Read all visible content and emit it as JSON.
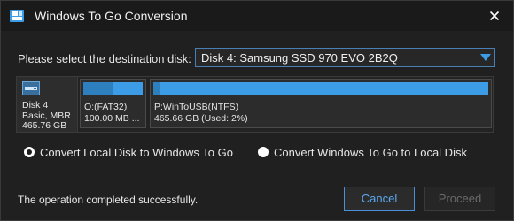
{
  "window": {
    "title": "Windows To Go Conversion"
  },
  "destination": {
    "label": "Please select the destination disk:",
    "selected": "Disk 4: Samsung SSD 970 EVO 2B2Q"
  },
  "disk": {
    "name": "Disk 4",
    "type": "Basic, MBR",
    "size": "465.76 GB",
    "partitions": [
      {
        "name": "O:(FAT32)",
        "size": "100.00 MB ...",
        "used_fraction": 0.5
      },
      {
        "name": "P:WinToUSB(NTFS)",
        "size": "465.66 GB (Used: 2%)",
        "used_fraction": 0.02
      }
    ]
  },
  "options": {
    "local_to_wtg": "Convert Local Disk to Windows To Go",
    "wtg_to_local": "Convert Windows To Go to Local Disk",
    "selected": "local_to_wtg"
  },
  "status": {
    "message": "The operation completed successfully."
  },
  "buttons": {
    "cancel": "Cancel",
    "proceed": "Proceed"
  },
  "colors": {
    "accent": "#3c9ce6",
    "background": "#202020"
  }
}
